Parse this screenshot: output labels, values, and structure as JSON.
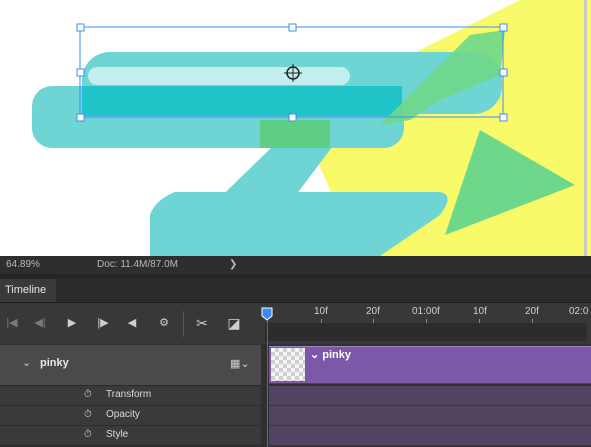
{
  "status_bar": {
    "zoom": "64.89%",
    "doc": "Doc: 11.4M/87.0M",
    "arrow": "❯"
  },
  "panel": {
    "tab": "Timeline"
  },
  "controls": {
    "first": "|◀",
    "prev": "◀|",
    "play": "▶",
    "next": "|▶",
    "audio": "◀",
    "settings": "⚙",
    "split": "✂",
    "transition": "◪"
  },
  "ruler": {
    "labels": [
      "10f",
      "20f",
      "01:00f",
      "10f",
      "20f",
      "02:0"
    ]
  },
  "layer": {
    "name": "pinky",
    "chevron": "⌄",
    "film_icon": "▦⌄"
  },
  "properties": [
    "Transform",
    "Opacity",
    "Style"
  ],
  "track": {
    "name": "pinky",
    "chevron": "⌄"
  },
  "colors": {
    "clip": "#7b58a8",
    "playhead": "#d23b3b",
    "accent": "#3b8cff"
  }
}
